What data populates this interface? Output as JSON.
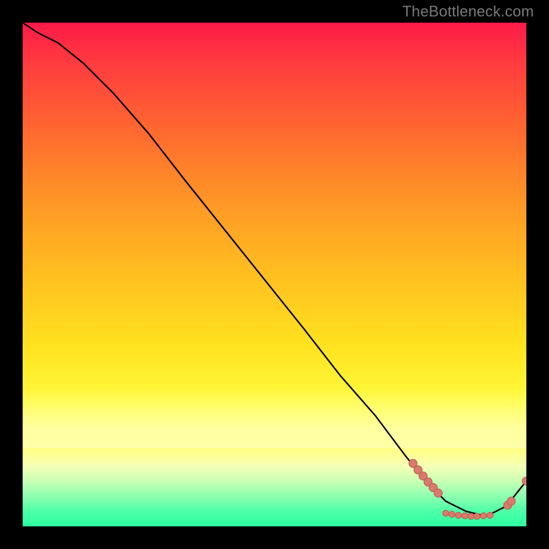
{
  "watermark": {
    "text": "TheBottleneck.com"
  },
  "colors": {
    "curve": "#000000",
    "dot_fill": "#d97a6c",
    "dot_stroke": "#b65d50"
  },
  "chart_data": {
    "type": "line",
    "title": "",
    "xlabel": "",
    "ylabel": "",
    "xlim": [
      0,
      100
    ],
    "ylim": [
      0,
      100
    ],
    "grid": false,
    "series": [
      {
        "name": "curve",
        "x": [
          0,
          3,
          7,
          12,
          18,
          25,
          32,
          40,
          48,
          56,
          63,
          70,
          76,
          80,
          84,
          88,
          92,
          96,
          100
        ],
        "y": [
          100,
          98,
          96,
          92,
          86,
          78,
          69,
          59,
          49,
          39,
          30,
          22,
          14,
          9,
          5,
          3,
          2,
          4,
          9
        ]
      }
    ],
    "scatter": [
      {
        "name": "cluster-upper",
        "x": [
          77.5,
          78.5,
          79.5,
          80.5,
          81.5,
          82.5
        ],
        "y": [
          12.5,
          11.2,
          10.0,
          8.8,
          7.7,
          6.6
        ],
        "r": 6
      },
      {
        "name": "cluster-bottom",
        "x": [
          84,
          85.2,
          86.5,
          87.8,
          89,
          90.2,
          91.5,
          92.8
        ],
        "y": [
          2.6,
          2.4,
          2.2,
          2.1,
          2.0,
          2.0,
          2.1,
          2.2
        ],
        "r": 4.5
      },
      {
        "name": "cluster-right",
        "x": [
          96.3,
          97.0
        ],
        "y": [
          4.2,
          5.0
        ],
        "r": 6
      },
      {
        "name": "dot-end",
        "x": [
          100
        ],
        "y": [
          9.0
        ],
        "r": 6
      }
    ]
  }
}
